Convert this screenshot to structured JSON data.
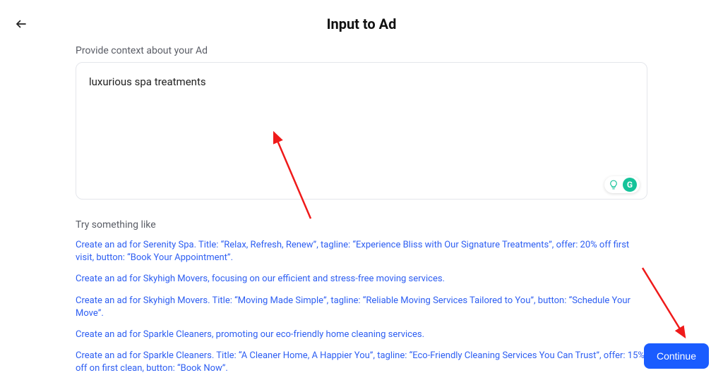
{
  "header": {
    "title": "Input to Ad"
  },
  "context": {
    "label": "Provide context about your Ad",
    "value": "luxurious spa treatments"
  },
  "suggestions": {
    "label": "Try something like",
    "items": [
      "Create an ad for Serenity Spa. Title: “Relax, Refresh, Renew”, tagline: “Experience Bliss with Our Signature Treatments”, offer: 20% off first visit, button: “Book Your Appointment”.",
      "Create an ad for Skyhigh Movers, focusing on our efficient and stress-free moving services.",
      "Create an ad for Skyhigh Movers. Title: “Moving Made Simple”, tagline: “Reliable Moving Services Tailored to You”, button: “Schedule Your Move”.",
      "Create an ad for Sparkle Cleaners, promoting our eco-friendly home cleaning services.",
      "Create an ad for Sparkle Cleaners. Title: “A Cleaner Home, A Happier You”, tagline: “Eco-Friendly Cleaning Services You Can Trust”, offer: 15% off on first clean, button: “Book Now”."
    ]
  },
  "actions": {
    "continue_label": "Continue"
  }
}
